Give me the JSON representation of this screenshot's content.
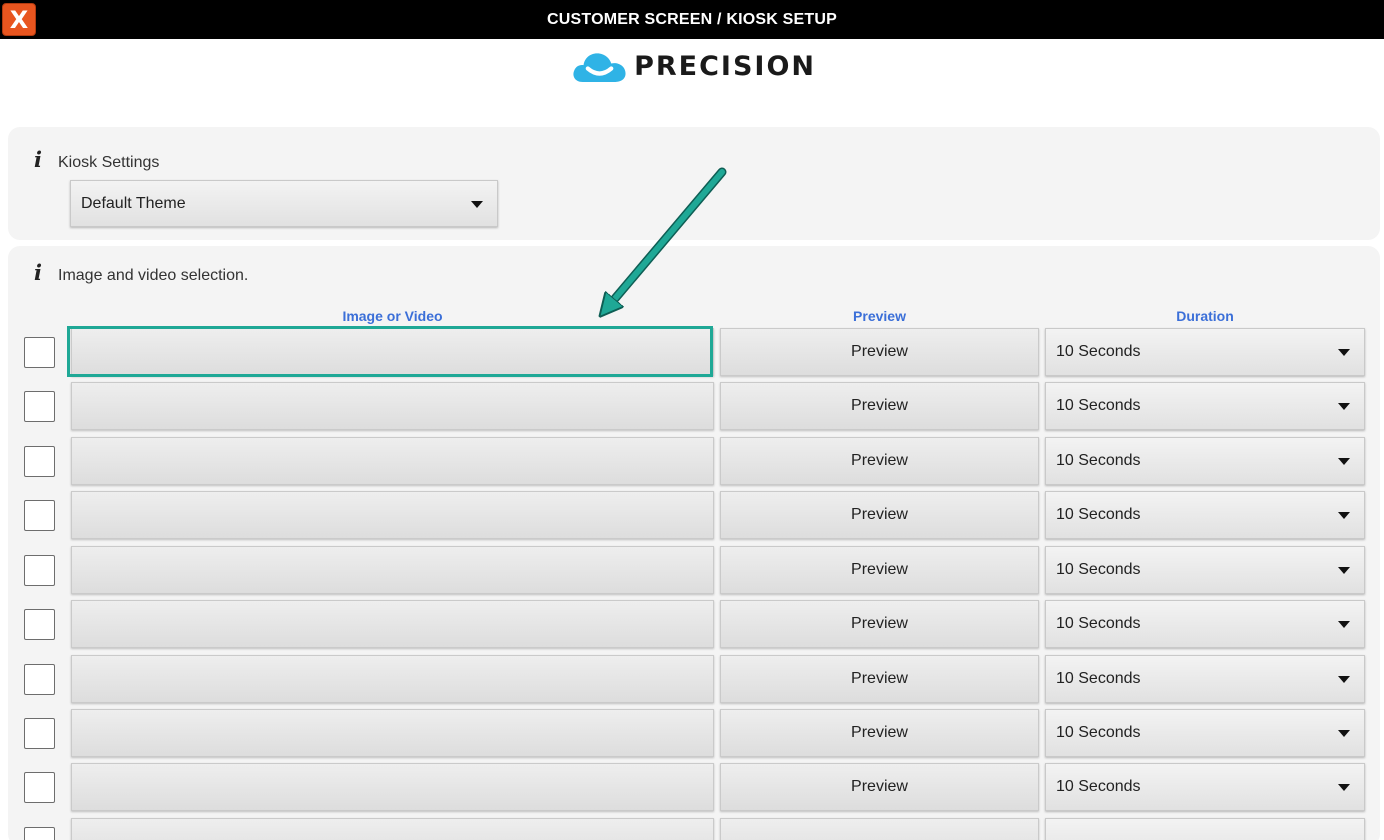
{
  "window": {
    "title": "CUSTOMER SCREEN / KIOSK SETUP",
    "close_label": "X"
  },
  "logo": {
    "text": "PRECISION",
    "cloud_color": "#2fb3e6"
  },
  "kiosk_settings": {
    "label": "Kiosk Settings",
    "theme_value": "Default Theme"
  },
  "media_selection": {
    "label": "Image and video selection.",
    "columns": {
      "media": "Image or Video",
      "preview": "Preview",
      "duration": "Duration"
    },
    "rows": [
      {
        "checked": false,
        "media": "",
        "preview_label": "Preview",
        "duration": "10 Seconds"
      },
      {
        "checked": false,
        "media": "",
        "preview_label": "Preview",
        "duration": "10 Seconds"
      },
      {
        "checked": false,
        "media": "",
        "preview_label": "Preview",
        "duration": "10 Seconds"
      },
      {
        "checked": false,
        "media": "",
        "preview_label": "Preview",
        "duration": "10 Seconds"
      },
      {
        "checked": false,
        "media": "",
        "preview_label": "Preview",
        "duration": "10 Seconds"
      },
      {
        "checked": false,
        "media": "",
        "preview_label": "Preview",
        "duration": "10 Seconds"
      },
      {
        "checked": false,
        "media": "",
        "preview_label": "Preview",
        "duration": "10 Seconds"
      },
      {
        "checked": false,
        "media": "",
        "preview_label": "Preview",
        "duration": "10 Seconds"
      },
      {
        "checked": false,
        "media": "",
        "preview_label": "Preview",
        "duration": "10 Seconds"
      },
      {
        "checked": false,
        "media": "",
        "preview_label": "",
        "duration": ""
      }
    ]
  },
  "colors": {
    "accent": "#1fa896",
    "column_header": "#3b6fd8",
    "close_button": "#e8551f"
  },
  "icons": {
    "close": "close-icon",
    "info": "info-icon",
    "dropdown": "chevron-down-icon"
  }
}
